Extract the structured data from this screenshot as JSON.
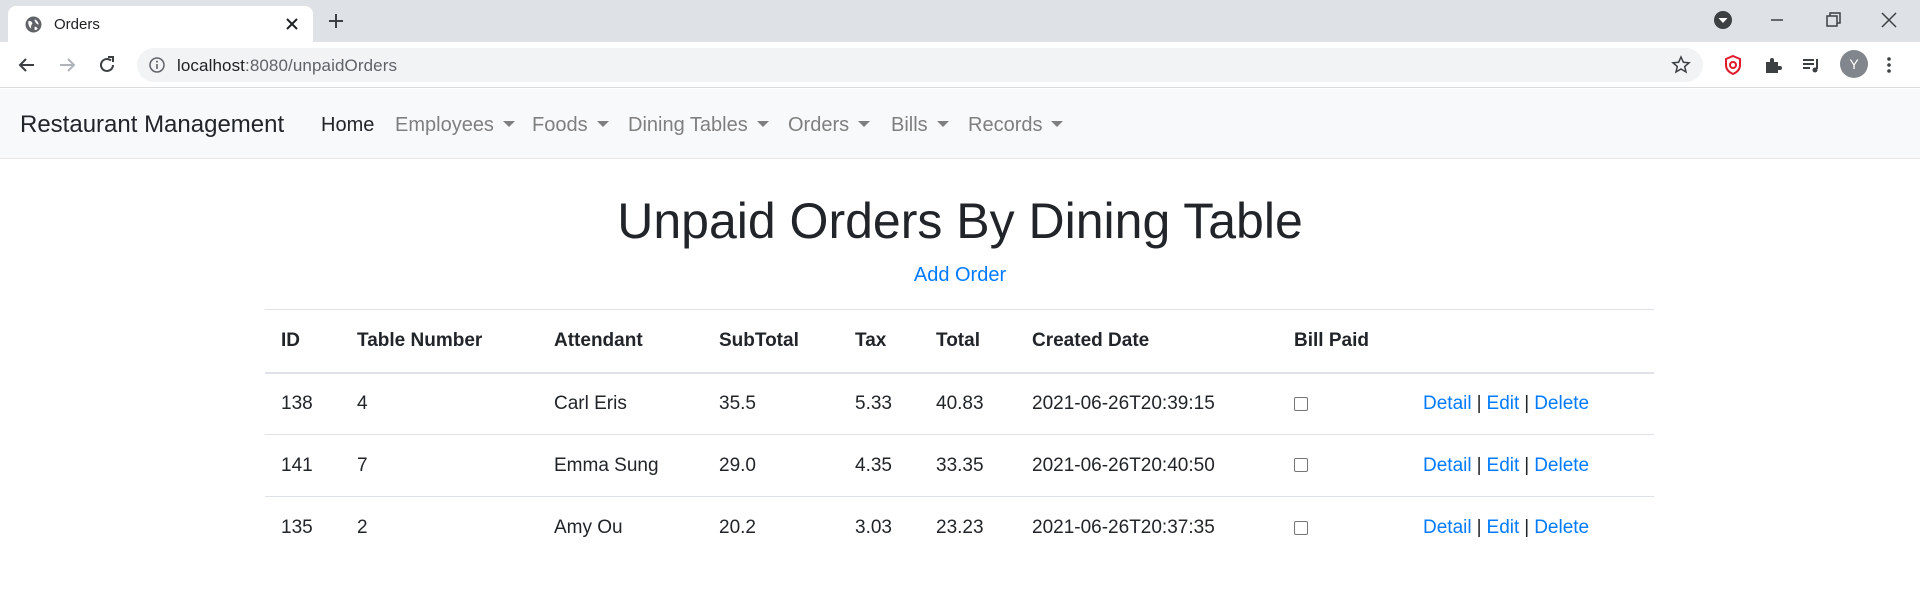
{
  "browser": {
    "tab_title": "Orders",
    "url_host": "localhost",
    "url_path": ":8080/unpaidOrders",
    "avatar_letter": "Y"
  },
  "navbar": {
    "brand": "Restaurant Management",
    "items": [
      {
        "label": "Home",
        "dropdown": false,
        "active": true
      },
      {
        "label": "Employees",
        "dropdown": true
      },
      {
        "label": "Foods",
        "dropdown": true
      },
      {
        "label": "Dining Tables",
        "dropdown": true
      },
      {
        "label": "Orders",
        "dropdown": true
      },
      {
        "label": "Bills",
        "dropdown": true
      },
      {
        "label": "Records",
        "dropdown": true
      }
    ]
  },
  "main": {
    "title": "Unpaid Orders By Dining Table",
    "add_link": "Add Order",
    "table": {
      "headers": [
        "ID",
        "Table Number",
        "Attendant",
        "SubTotal",
        "Tax",
        "Total",
        "Created Date",
        "Bill Paid",
        ""
      ],
      "rows": [
        {
          "id": "138",
          "table_number": "4",
          "attendant": "Carl Eris",
          "subtotal": "35.5",
          "tax": "5.33",
          "total": "40.83",
          "created_date": "2021-06-26T20:39:15",
          "bill_paid": false
        },
        {
          "id": "141",
          "table_number": "7",
          "attendant": "Emma Sung",
          "subtotal": "29.0",
          "tax": "4.35",
          "total": "33.35",
          "created_date": "2021-06-26T20:40:50",
          "bill_paid": false
        },
        {
          "id": "135",
          "table_number": "2",
          "attendant": "Amy Ou",
          "subtotal": "20.2",
          "tax": "3.03",
          "total": "23.23",
          "created_date": "2021-06-26T20:37:35",
          "bill_paid": false
        }
      ],
      "actions": {
        "detail": "Detail",
        "edit": "Edit",
        "delete": "Delete",
        "separator": "|"
      }
    }
  },
  "colors": {
    "link": "#007bff",
    "navbar_bg": "#f8f9fa",
    "text": "#212529"
  }
}
